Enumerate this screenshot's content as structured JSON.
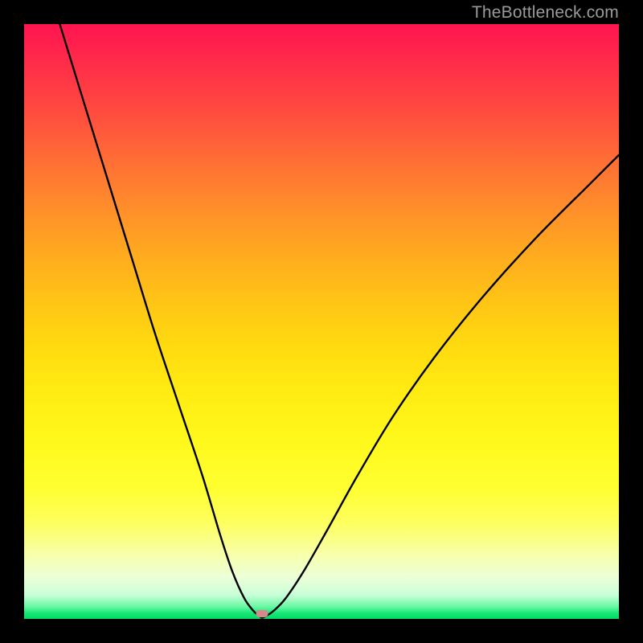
{
  "watermark": "TheBottleneck.com",
  "chart_data": {
    "type": "line",
    "title": "",
    "xlabel": "",
    "ylabel": "",
    "xlim": [
      0,
      100
    ],
    "ylim": [
      0,
      100
    ],
    "grid": false,
    "series": [
      {
        "name": "bottleneck-curve",
        "x": [
          6,
          10,
          14,
          18,
          22,
          26,
          30,
          33,
          35,
          37,
          38.5,
          39.5,
          40,
          40.7,
          42,
          44,
          47,
          51,
          56,
          62,
          69,
          77,
          86,
          95,
          100
        ],
        "y": [
          100,
          87,
          74,
          61,
          48,
          36,
          24,
          14,
          8,
          3.5,
          1.4,
          0.5,
          0.2,
          0.5,
          1.4,
          3.5,
          8,
          15,
          24,
          34,
          44,
          54,
          64,
          73,
          78
        ]
      }
    ],
    "marker": {
      "x": 40,
      "y": 0,
      "color": "#d48a8a"
    },
    "background_gradient": {
      "top": "#ff1450",
      "mid": "#ffe820",
      "bottom": "#04d864"
    }
  }
}
